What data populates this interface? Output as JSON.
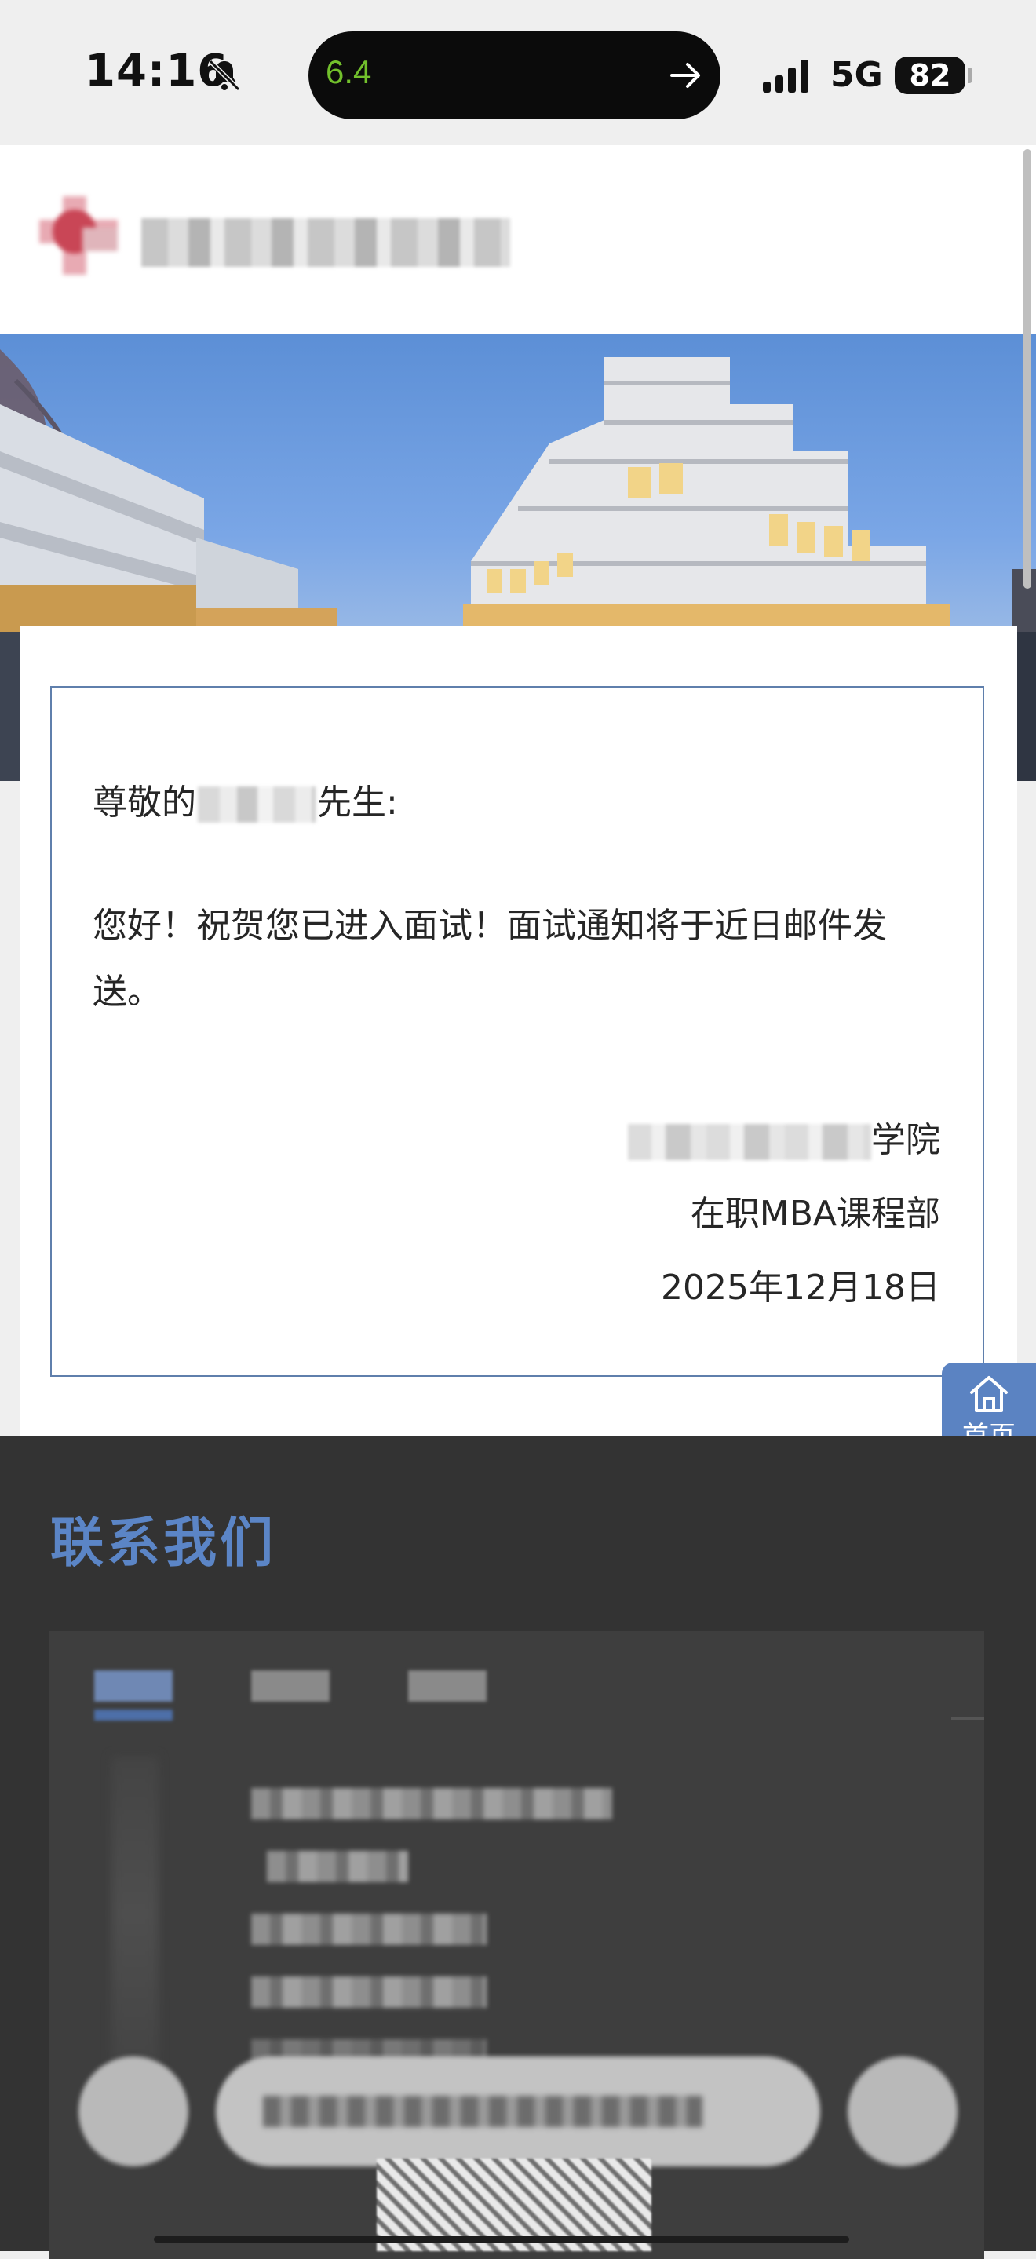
{
  "status_bar": {
    "time": "14:16",
    "island_text": "6.4",
    "network": "5G",
    "battery": "82"
  },
  "letter": {
    "salutation_prefix": "尊敬的",
    "salutation_suffix": "先生:",
    "body": "您好！祝贺您已进入面试！面试通知将于近日邮件发送。",
    "school_suffix": "学院",
    "department": "在职MBA课程部",
    "date": "2025年12月18日"
  },
  "home_button": {
    "label": "首页"
  },
  "footer": {
    "title": "联系我们"
  },
  "colors": {
    "accent": "#5b85c6",
    "footer_bg": "#333333",
    "frame": "#5f7fac"
  }
}
